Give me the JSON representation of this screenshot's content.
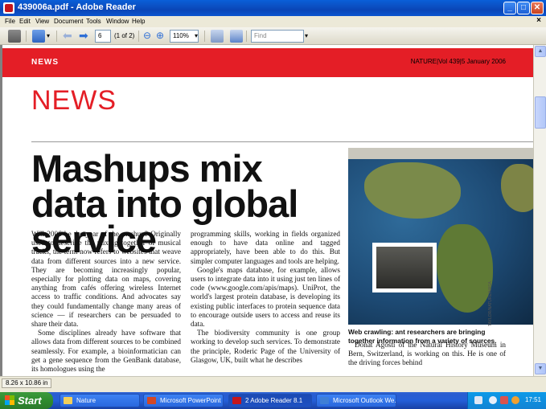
{
  "window": {
    "title": "439006a.pdf - Adobe Reader"
  },
  "menu": [
    "File",
    "Edit",
    "View",
    "Document",
    "Tools",
    "Window",
    "Help"
  ],
  "toolbar": {
    "page_number": "6",
    "page_count": "(1 of 2)",
    "zoom": "110%",
    "find_placeholder": "Find"
  },
  "document": {
    "section_tag": "NEWS",
    "issue_line": "NATURE|Vol 439|5 January 2006",
    "section_title": "NEWS",
    "headline": "Mashups mix data into global service",
    "column1": [
      "Will 2006 be the year of the mashup? Originally used to describe the mixing together of musical tracks, the term now refers to websites that weave data from different sources into a new service. They are becoming increasingly popular, especially for plotting data on maps, covering anything from cafés offering wireless Internet access to traffic conditions. And advocates say they could fundamentally change many areas of science — if researchers can be persuaded to share their data.",
      "Some disciplines already have software that allows data from different sources to be combined seamlessly. For example, a bioinformatician can get a gene sequence from the GenBank database, its homologues using the"
    ],
    "column2": [
      "programming skills, working in fields organized enough to have data online and tagged appropriately, have been able to do this. But simpler computer languages and tools are helping.",
      "Google's maps database, for example, allows users to integrate data into it using just ten lines of code (www.google.com/apis/maps). UniProt, the world's largest protein database, is developing its existing public interfaces to protein sequence data to encourage outside users to access and reuse its data.",
      "The biodiversity community is one group working to develop such services. To demonstrate the principle, Roderic Page of the University of Glasgow, UK, built what he describes"
    ],
    "column3": "Donat Agosti of the Natural History Museum in Bern, Switzerland, is working on this. He is one of the driving forces behind",
    "caption": "Web crawling: ant researchers are bringing together information from a variety of sources.",
    "photo_credit": "TAYLOR/NATURE/NASA"
  },
  "status": {
    "page_size": "8.26 x 10.86 in"
  },
  "taskbar": {
    "start_label": "Start",
    "tasks": [
      "Nature",
      "Microsoft PowerPoint ...",
      "2 Adobe Reader 8.1",
      "Microsoft Outlook We..."
    ],
    "clock": "17:51"
  },
  "colors": {
    "accent_red": "#e41e26",
    "title_blue": "#0b55cf",
    "taskbar_blue": "#245ed8"
  }
}
